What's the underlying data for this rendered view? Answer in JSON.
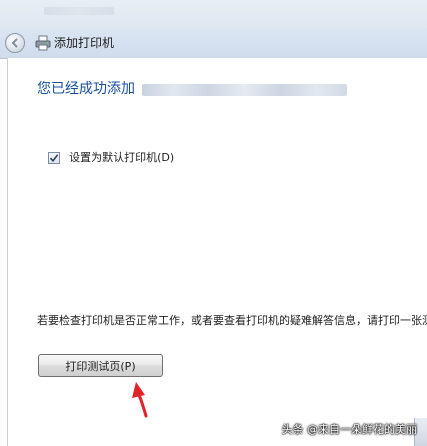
{
  "window": {
    "title": "添加打印机"
  },
  "main": {
    "heading": "您已经成功添加",
    "checkbox": {
      "label": "设置为默认打印机(D)",
      "checked": true
    },
    "info_text": "若要检查打印机是否正常工作，或者要查看打印机的疑难解答信息，请打印一张测",
    "test_page_button": "打印测试页(P)"
  },
  "watermark": "头条 @来自一朵鲜花的美丽",
  "icons": {
    "back": "back-arrow-icon",
    "printer": "printer-icon",
    "checkmark": "checkmark-icon",
    "annotation_arrow": "red-arrow-icon"
  },
  "colors": {
    "heading": "#1a4fa0",
    "annotation_arrow": "#e0242a",
    "titlebar": "#d5e1ef"
  }
}
